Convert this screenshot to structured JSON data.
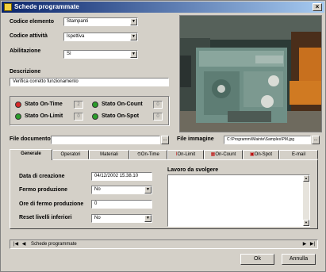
{
  "window": {
    "title": "Schede programmate",
    "close_glyph": "×"
  },
  "form": {
    "codice_elemento": {
      "label": "Codice elemento",
      "value": "Stampanti"
    },
    "codice_attivita": {
      "label": "Codice attività",
      "value": "Ispettiva"
    },
    "abilitazione": {
      "label": "Abilitazione",
      "value": "Sì"
    },
    "descrizione": {
      "label": "Descrizione",
      "value": "Verifica corretto funzionamento"
    }
  },
  "status": {
    "on_time": {
      "label": "Stato On-Time",
      "color": "#d62828",
      "value": "2"
    },
    "on_limit": {
      "label": "Stato On-Limit",
      "color": "#2a9d2a",
      "value": "0"
    },
    "on_count": {
      "label": "Stato On-Count",
      "color": "#2a9d2a",
      "value": "0"
    },
    "on_spot": {
      "label": "Stato On-Spot",
      "color": "#2a9d2a",
      "value": "0"
    }
  },
  "files": {
    "documento": {
      "label": "File documento",
      "value": ""
    },
    "immagine": {
      "label": "File immagine",
      "value": "C:\\Programmi\\Mainte\\Samples\\PM.jpg"
    },
    "browse_glyph": "..."
  },
  "tabs": [
    {
      "label": "Generale",
      "icon": ""
    },
    {
      "label": "Operatori",
      "icon": ""
    },
    {
      "label": "Materiali",
      "icon": ""
    },
    {
      "label": "On-Time",
      "icon": "clock-icon"
    },
    {
      "label": "On-Limit",
      "icon": "limit-icon"
    },
    {
      "label": "On-Count",
      "icon": "count-icon"
    },
    {
      "label": "On-Spot",
      "icon": "spot-icon"
    },
    {
      "label": "E-mail",
      "icon": ""
    }
  ],
  "generale": {
    "data_creazione": {
      "label": "Data di creazione",
      "value": "04/12/2002 15.38.10"
    },
    "fermo_produzione": {
      "label": "Fermo produzione",
      "value": "No"
    },
    "ore_fermo": {
      "label": "Ore di fermo produzione",
      "value": "0"
    },
    "reset_livelli": {
      "label": "Reset livelli inferiori",
      "value": "No"
    },
    "lavoro": {
      "label": "Lavoro da svolgere",
      "value": ""
    }
  },
  "navigator": {
    "label": "Schede programmate"
  },
  "buttons": {
    "ok": "Ok",
    "annulla": "Annulla"
  }
}
